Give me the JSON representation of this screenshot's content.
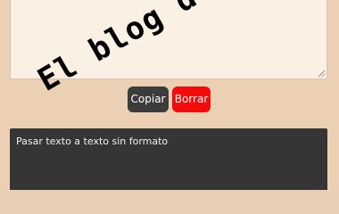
{
  "buttons": {
    "copy_label": "Copiar",
    "delete_label": "Borrar"
  },
  "output": {
    "label": "Pasar texto a texto sin formato"
  },
  "watermark": {
    "text": "El blog de joasoi"
  },
  "colors": {
    "page_background": "#ebd0b4",
    "textarea_background": "#fbf0e4",
    "copy_button": "#3c3c3c",
    "delete_button": "#f40b0b",
    "output_panel": "#353535"
  }
}
